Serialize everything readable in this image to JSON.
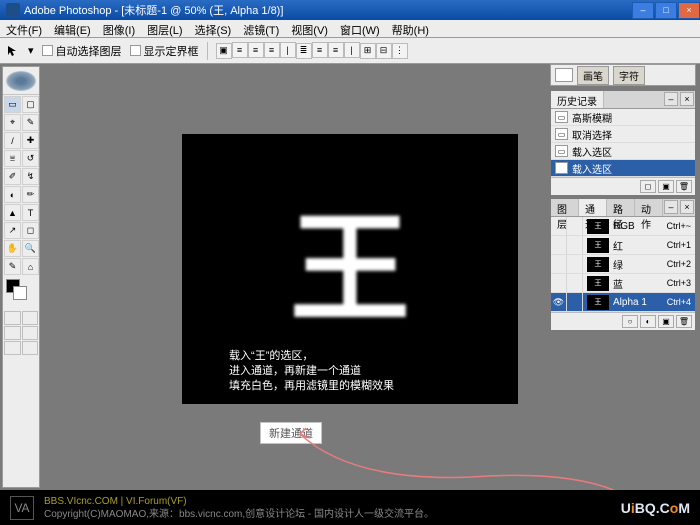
{
  "title": "Adobe Photoshop - [未标题-1 @ 50% (王, Alpha 1/8)]",
  "menu": [
    "文件(F)",
    "编辑(E)",
    "图像(I)",
    "图层(L)",
    "选择(S)",
    "滤镜(T)",
    "视图(V)",
    "窗口(W)",
    "帮助(H)"
  ],
  "opt": {
    "auto_select_layer": "自动选择图层",
    "show_bounds": "显示定界框",
    "align_icons": [
      "▣",
      "≡",
      "≡",
      "≡",
      "|",
      "≣",
      "≡",
      "≡",
      "|",
      "⊞",
      "⊟",
      "⋮"
    ]
  },
  "dock_tabs": [
    "画笔",
    "字符"
  ],
  "history": {
    "title": "历史记录",
    "items": [
      "高斯模糊",
      "取消选择",
      "载入选区",
      "载入选区"
    ],
    "selected": 3
  },
  "channels_panel": {
    "tabs": [
      "图层",
      "通道",
      "路径",
      "动作"
    ],
    "active_tab": 1,
    "rows": [
      {
        "name": "RGB",
        "short": "Ctrl+~",
        "eye": false,
        "thumb": "王"
      },
      {
        "name": "红",
        "short": "Ctrl+1",
        "eye": false,
        "thumb": "王"
      },
      {
        "name": "绿",
        "short": "Ctrl+2",
        "eye": false,
        "thumb": "王"
      },
      {
        "name": "蓝",
        "short": "Ctrl+3",
        "eye": false,
        "thumb": "王"
      },
      {
        "name": "Alpha 1",
        "short": "Ctrl+4",
        "eye": true,
        "thumb": "王",
        "selected": true
      }
    ]
  },
  "canvas_glyph": "王",
  "canvas_text": [
    "载入“王”的选区，",
    "进入通道，再新建一个通道",
    "填充白色，再用滤镜里的模糊效果"
  ],
  "annotation": "新建通道",
  "footer": {
    "line1": "BBS.VIcnc.COM | VI.Forum(VF)",
    "line2": "Copyright(C)MAOMAO,来源：bbs.vicnc.com,创意设计论坛 - 国内设计人一级交流平台。",
    "brand": "UiBQ.CoM",
    "logo": "VA"
  },
  "tools": [
    "▭",
    "▢",
    "⌖",
    "✎",
    "/",
    "✚",
    "⩸",
    "↺",
    "✐",
    "↯",
    "◐",
    "✏",
    "▲",
    "T",
    "↗",
    "◻",
    "✋",
    "🔍",
    "✎",
    "⌂"
  ]
}
